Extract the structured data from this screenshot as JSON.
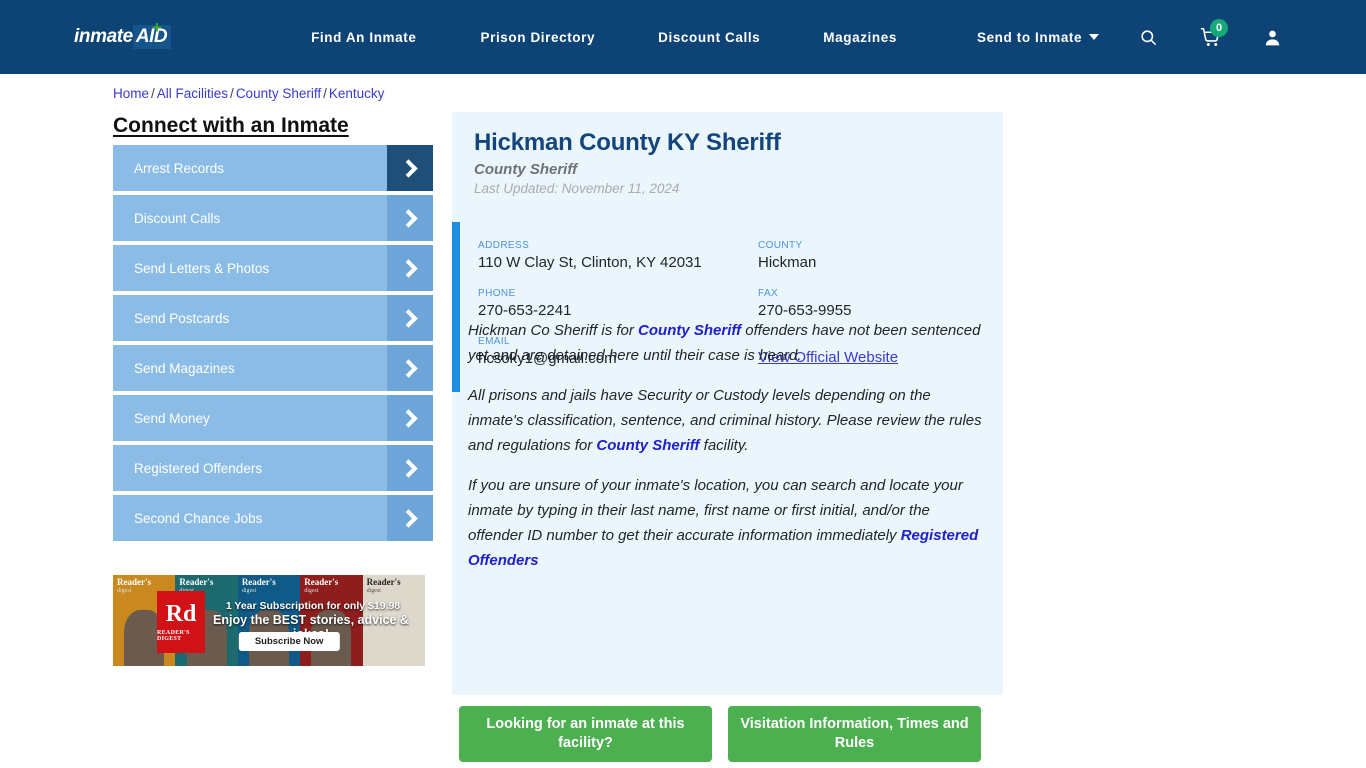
{
  "nav": {
    "logo": {
      "text": "inmate",
      "badge": "AID",
      "plus": "+"
    },
    "links": [
      {
        "label": "Find An Inmate"
      },
      {
        "label": "Prison Directory"
      },
      {
        "label": "Discount Calls"
      },
      {
        "label": "Magazines"
      },
      {
        "label": "Send to Inmate"
      }
    ],
    "icons": {
      "search": "search-icon",
      "cart": "cart-icon",
      "cart_count": "0",
      "user": "user-icon"
    }
  },
  "breadcrumb": {
    "items": [
      "Home",
      "All Facilities",
      "County Sheriff",
      "Kentucky"
    ],
    "separator": "/"
  },
  "sidebar": {
    "title": "Connect with an Inmate",
    "items": [
      {
        "label": "Arrest Records"
      },
      {
        "label": "Discount Calls"
      },
      {
        "label": "Send Letters & Photos"
      },
      {
        "label": "Send Postcards"
      },
      {
        "label": "Send Magazines"
      },
      {
        "label": "Send Money"
      },
      {
        "label": "Registered Offenders"
      },
      {
        "label": "Second Chance Jobs"
      }
    ]
  },
  "ad": {
    "brand": "Rd",
    "brand_sub": "READER'S DIGEST",
    "line1": "1 Year Subscription for only $19.98",
    "line2": "Enjoy the BEST stories, advice & jokes!",
    "cta": "Subscribe Now",
    "covers": [
      {
        "title": "Reader's",
        "sub": "digest"
      },
      {
        "title": "Reader's",
        "sub": "digest"
      },
      {
        "title": "Reader's",
        "sub": "digest"
      },
      {
        "title": "Reader's",
        "sub": "digest"
      },
      {
        "title": "Reader's",
        "sub": "digest"
      }
    ]
  },
  "facility": {
    "title": "Hickman County KY Sheriff",
    "type": "County Sheriff",
    "last_updated": "Last Updated: November 11, 2024",
    "info": {
      "address_label": "ADDRESS",
      "address_value": "110 W Clay St, Clinton, KY 42031",
      "county_label": "COUNTY",
      "county_value": "Hickman",
      "phone_label": "PHONE",
      "phone_value": "270-653-2241",
      "fax_label": "FAX",
      "fax_value": "270-653-9955",
      "email_label": "EMAIL",
      "email_value": "hcsoky1@gmail.com",
      "website_link": "View Official Website"
    },
    "paragraphs": {
      "p1_a": "Hickman Co Sheriff is for ",
      "p1_link": "County Sheriff",
      "p1_b": " offenders have not been sentenced yet and are detained here until their case is heard.",
      "p2_a": "All prisons and jails have Security or Custody levels depending on the inmate's classification, sentence, and criminal history. Please review the rules and regulations for ",
      "p2_link": "County Sheriff",
      "p2_b": " facility.",
      "p3_a": "If you are unsure of your inmate's location, you can search and locate your inmate by typing in their last name, first name or first initial, and/or the offender ID number to get their accurate information immediately ",
      "p3_link": "Registered Offenders"
    }
  },
  "cta_buttons": [
    {
      "label": "Looking for an inmate at this facility?"
    },
    {
      "label": "Visitation Information, Times and Rules"
    }
  ],
  "colors": {
    "nav_bg": "#0e4375",
    "panel_bg": "#eaf5fc",
    "accent_blue": "#1e8fe0",
    "title_navy": "#14457c",
    "sidebar_item": "#8bbce6",
    "sidebar_chev": "#6da5d8",
    "sidebar_chev_active": "#1f4e79",
    "cta_green": "#4caf50",
    "link_blue": "#3a3ad0",
    "badge_green": "#15a97a"
  }
}
